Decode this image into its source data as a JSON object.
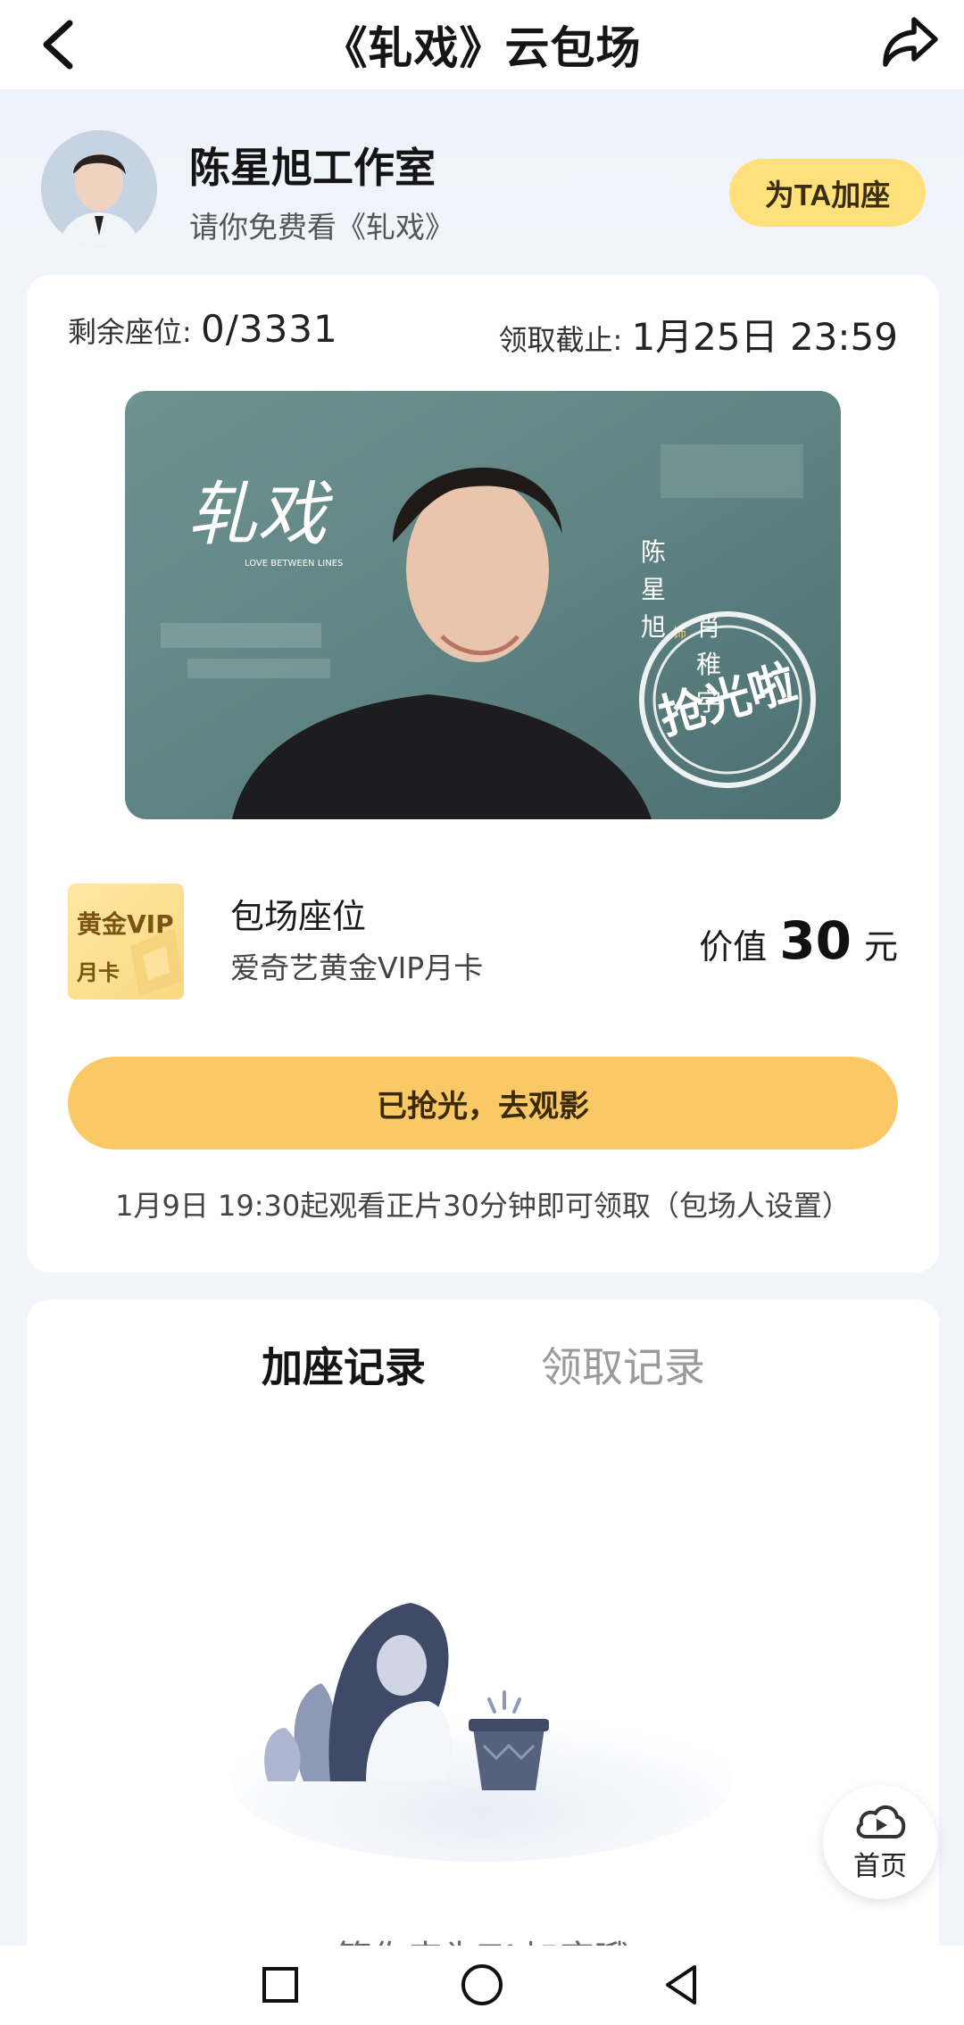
{
  "topbar": {
    "title": "《轧戏》云包场",
    "back_icon": "chevron-left-icon",
    "share_icon": "share-arrow-icon"
  },
  "host": {
    "name": "陈星旭工作室",
    "subtitle": "请你免费看《轧戏》",
    "add_seat_label": "为TA加座"
  },
  "seats": {
    "remaining_label": "剩余座位:",
    "remaining_value": "0/3331",
    "deadline_label": "领取截止:",
    "deadline_value": "1月25日 23:59"
  },
  "poster": {
    "logo_text": "轧戏",
    "logo_en": "LOVE BETWEEN LINES",
    "actor_col1": "陈星旭",
    "role_tag": "饰",
    "actor_col2": "肖稚宇",
    "stamp_text": "抢光啦"
  },
  "vip": {
    "badge_line1": "黄金VIP",
    "badge_line2": "月卡",
    "title": "包场座位",
    "subtitle": "爱奇艺黄金VIP月卡",
    "value_label": "价值",
    "value_amount": "30",
    "value_unit": "元"
  },
  "main_button_label": "已抢光，去观影",
  "note": "1月9日 19:30起观看正片30分钟即可领取（包场人设置）",
  "tabs": [
    {
      "label": "加座记录",
      "active": true
    },
    {
      "label": "领取记录",
      "active": false
    }
  ],
  "empty_text": "等你来为TA加座哦",
  "float_home": {
    "label": "首页",
    "icon": "cloud-play-icon"
  },
  "nav": [
    "square-icon",
    "circle-icon",
    "triangle-back-icon"
  ],
  "colors": {
    "accent_yellow": "#fbc866",
    "badge_yellow": "#ffe07a",
    "page_bg": "#f2f5fb"
  }
}
